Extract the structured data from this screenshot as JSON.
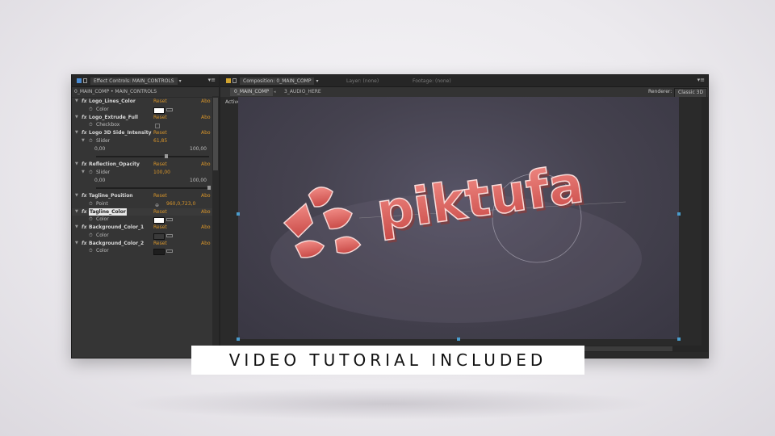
{
  "left_panel": {
    "tab_title": "Effect Controls: MAIN_CONTROLS",
    "dropdown_glyph": "▾",
    "menu_glyph": "▾≡",
    "breadcrumb": "0_MAIN_COMP • MAIN_CONTROLS",
    "reset_label": "Reset",
    "about_label": "Abo",
    "effects": [
      {
        "name": "Logo_Lines_Color",
        "param": "Color",
        "type": "color",
        "swatch": "#ffffff"
      },
      {
        "name": "Logo_Extrude_Full",
        "param": "Checkbox",
        "type": "checkbox"
      },
      {
        "name": "Logo 3D Side_Intensity",
        "param": "Slider",
        "type": "slider",
        "value": "61,85",
        "min": "0,00",
        "max": "100,00",
        "fraction": 0.62
      },
      {
        "name": "Reflection_Opacity",
        "param": "Slider",
        "type": "slider",
        "value": "100,00",
        "min": "0,00",
        "max": "100,00",
        "fraction": 1.0
      },
      {
        "name": "Tagline_Position",
        "param": "Point",
        "type": "point",
        "value": "960,0,723,0"
      },
      {
        "name": "Tagline_Color",
        "param": "Color",
        "type": "color",
        "swatch": "#ffffff",
        "selected": true
      },
      {
        "name": "Background_Color_1",
        "param": "Color",
        "type": "color",
        "swatch": "#3a3a3a"
      },
      {
        "name": "Background_Color_2",
        "param": "Color",
        "type": "color",
        "swatch": "#1e1e1e"
      }
    ]
  },
  "right_panel": {
    "tab_title": "Composition: 0_MAIN_COMP",
    "layer_label": "Layer: (none)",
    "footage_label": "Footage: (none)",
    "active_subtab": "0_MAIN_COMP",
    "subtab_arrow": "◂",
    "second_subtab": "3_AUDIO_HERE",
    "renderer_label": "Renderer:",
    "renderer_value": "Classic 3D",
    "camera_label": "Active Camera",
    "logo_text": "piktufa"
  },
  "banner": {
    "text": "VIDEO TUTORIAL INCLUDED"
  },
  "colors": {
    "accent_orange": "#d8952a",
    "logo_red": "#e4625e",
    "canvas_bg": "#45424f",
    "handle_blue": "#4a9ccc"
  }
}
